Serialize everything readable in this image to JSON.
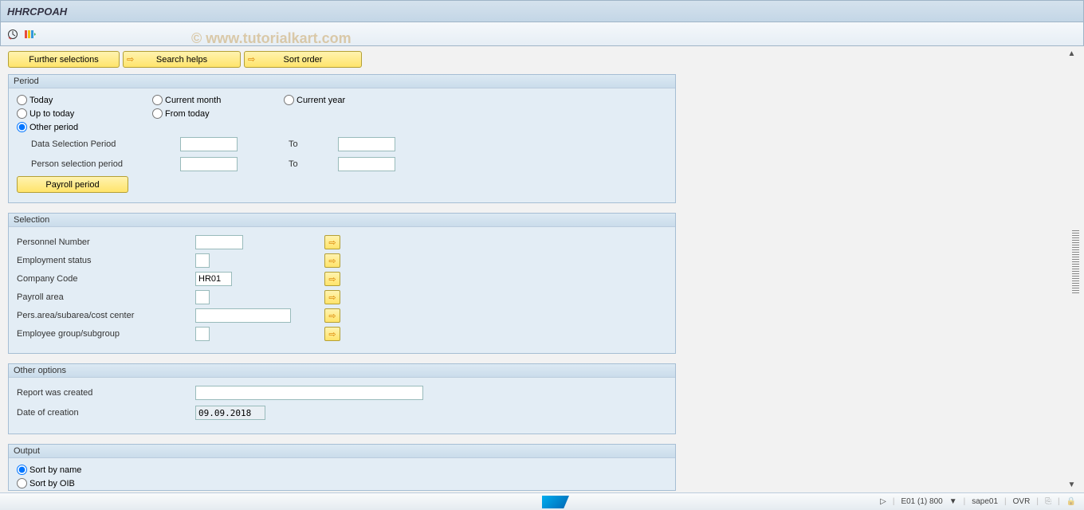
{
  "title": "HHRCPOAH",
  "watermark": "© www.tutorialkart.com",
  "buttons": {
    "further_selections": "Further selections",
    "search_helps": "Search helps",
    "sort_order": "Sort order",
    "payroll_period": "Payroll period"
  },
  "period": {
    "title": "Period",
    "today": "Today",
    "current_month": "Current month",
    "current_year": "Current year",
    "up_to_today": "Up to today",
    "from_today": "From today",
    "other_period": "Other period",
    "data_selection_period": "Data Selection Period",
    "person_selection_period": "Person selection period",
    "to": "To"
  },
  "selection": {
    "title": "Selection",
    "personnel_number": "Personnel Number",
    "employment_status": "Employment status",
    "company_code": "Company Code",
    "company_code_value": "HR01",
    "payroll_area": "Payroll area",
    "pers_area": "Pers.area/subarea/cost center",
    "employee_group": "Employee group/subgroup"
  },
  "other_options": {
    "title": "Other options",
    "report_was_created": "Report was created",
    "date_of_creation": "Date of creation",
    "date_value": "09.09.2018"
  },
  "output": {
    "title": "Output",
    "sort_by_name": "Sort by name",
    "sort_by_oib": "Sort by OIB"
  },
  "status": {
    "triangle": "▷",
    "system": "E01 (1) 800",
    "dropdown": "▼",
    "server": "sape01",
    "mode": "OVR"
  }
}
